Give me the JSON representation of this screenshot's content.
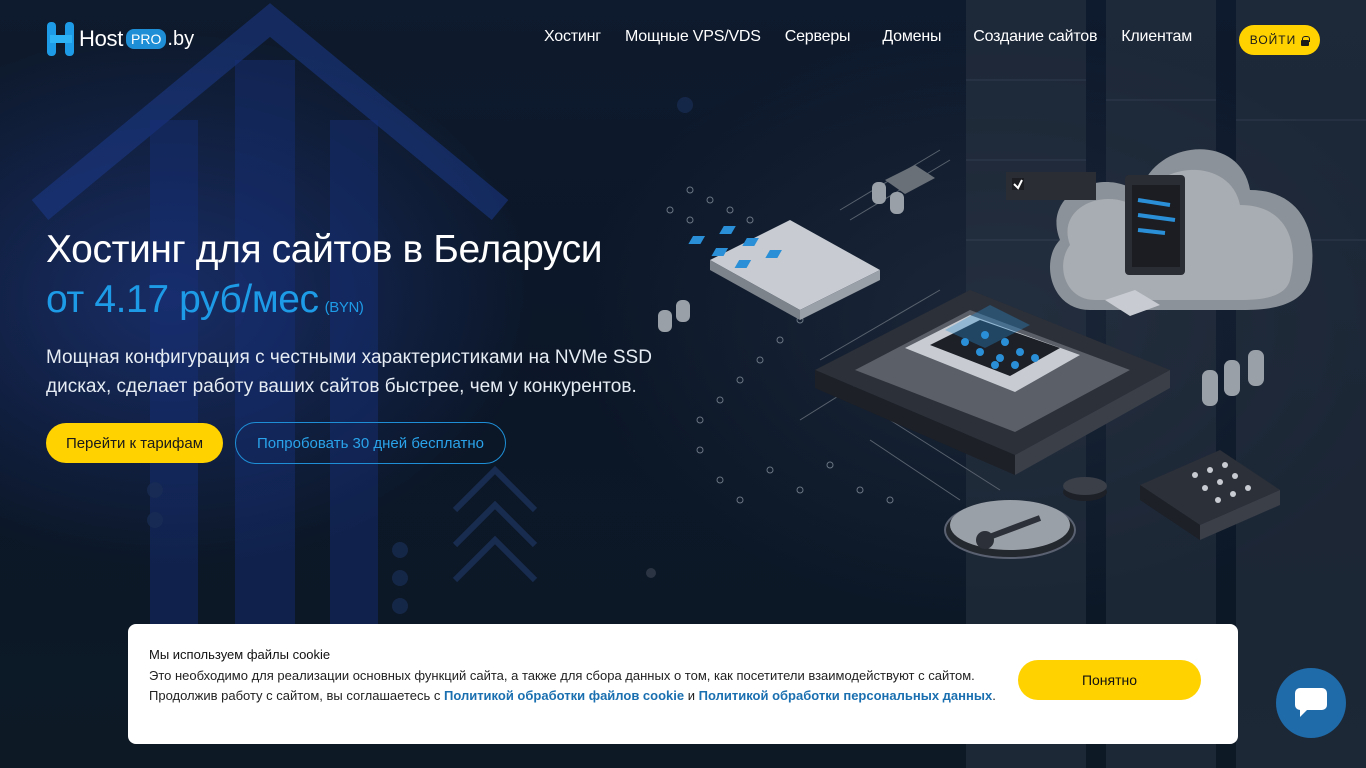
{
  "header": {
    "logo": {
      "host": "Host",
      "pro": "PRO",
      "by": ".by"
    },
    "nav": [
      {
        "label": "Хостинг"
      },
      {
        "label": "Мощные VPS/VDS"
      },
      {
        "label": "Серверы"
      },
      {
        "label": "Домены"
      },
      {
        "label": "Создание сайтов"
      },
      {
        "label": "Клиентам"
      }
    ],
    "login_label": "ВОЙТИ",
    "login_icon": "lock-icon"
  },
  "hero": {
    "title": "Хостинг для сайтов в Беларуси",
    "price": "от 4.17 руб/мес",
    "price_unit": "(BYN)",
    "description": "Мощная конфигурация с честными характеристиками на NVMe SSD дисках, сделает работу ваших сайтов быстрее, чем у конкурентов.",
    "cta_primary": "Перейти к тарифам",
    "cta_secondary": "Попробовать 30 дней бесплатно"
  },
  "cookie": {
    "title": "Мы используем файлы cookie",
    "text_start": "Это необходимо для реализации основных функций сайта, а также для сбора данных о том, как посетители взаимодействуют с сайтом. Продолжив работу с сайтом, вы соглашаетесь с ",
    "link_cookie": "Политикой обработки файлов cookie",
    "text_and": " и ",
    "link_personal": "Политикой обработки персональных данных",
    "text_end": ".",
    "accept_label": "Понятно"
  },
  "chat": {
    "icon": "chat-bubble-icon"
  },
  "colors": {
    "accent_yellow": "#ffd200",
    "accent_blue": "#1e9be6",
    "background": "#0b1524"
  }
}
